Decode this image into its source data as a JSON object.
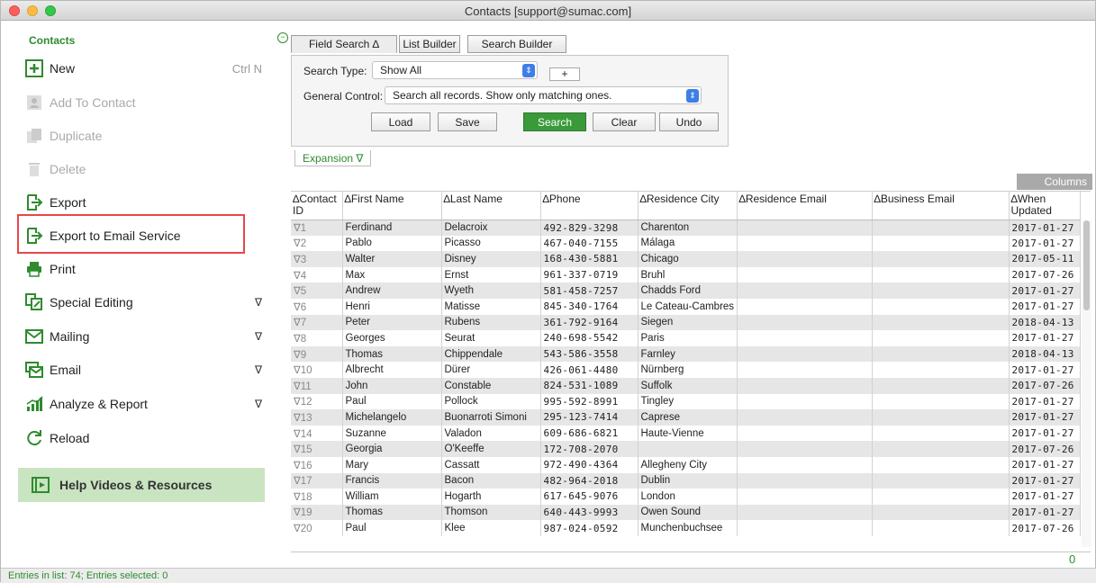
{
  "window": {
    "title": "Contacts   [support@sumac.com]"
  },
  "sidebar": {
    "heading": "Contacts",
    "items": [
      {
        "label": "New",
        "shortcut": "Ctrl N",
        "icon": "new-icon",
        "enabled": true
      },
      {
        "label": "Add To Contact",
        "icon": "add-to-contact-icon",
        "enabled": false
      },
      {
        "label": "Duplicate",
        "icon": "duplicate-icon",
        "enabled": false
      },
      {
        "label": "Delete",
        "icon": "trash-icon",
        "enabled": false
      },
      {
        "label": "Export",
        "icon": "export-icon",
        "enabled": true
      },
      {
        "label": "Export to Email Service",
        "icon": "export-icon",
        "enabled": true,
        "highlighted": true
      },
      {
        "label": "Print",
        "icon": "printer-icon",
        "enabled": true
      },
      {
        "label": "Special Editing",
        "icon": "special-editing-icon",
        "enabled": true,
        "submenu": "∇"
      },
      {
        "label": "Mailing",
        "icon": "mailing-icon",
        "enabled": true,
        "submenu": "∇"
      },
      {
        "label": "Email",
        "icon": "email-icon",
        "enabled": true,
        "submenu": "∇"
      },
      {
        "label": "Analyze & Report",
        "icon": "chart-icon",
        "enabled": true,
        "submenu": "∇"
      },
      {
        "label": "Reload",
        "icon": "reload-icon",
        "enabled": true
      }
    ],
    "help": "Help Videos & Resources"
  },
  "search": {
    "tabs": [
      "Field Search ∆",
      "List Builder",
      "Search Builder"
    ],
    "search_type_label": "Search Type:",
    "search_type_value": "Show All",
    "plus_label": "+",
    "general_control_label": "General Control:",
    "general_control_value": "Search all records. Show only matching ones.",
    "buttons": [
      "Load",
      "Save",
      "Search",
      "Clear",
      "Undo"
    ],
    "expansion_label": "Expansion ∇"
  },
  "columns_button": "Columns",
  "table": {
    "headers": [
      "∆Contact ID",
      "∆First Name",
      "∆Last Name",
      "∆Phone",
      "∆Residence City",
      "∆Residence Email",
      "∆Business Email",
      "∆When Updated"
    ],
    "rows": [
      [
        "∇1",
        "Ferdinand",
        "Delacroix",
        "492-829-3298",
        "Charenton",
        "",
        "",
        "2017-01-27"
      ],
      [
        "∇2",
        "Pablo",
        "Picasso",
        "467-040-7155",
        "Málaga",
        "",
        "",
        "2017-01-27"
      ],
      [
        "∇3",
        "Walter",
        "Disney",
        "168-430-5881",
        "Chicago",
        "",
        "",
        "2017-05-11"
      ],
      [
        "∇4",
        "Max",
        "Ernst",
        "961-337-0719",
        "Bruhl",
        "",
        "",
        "2017-07-26"
      ],
      [
        "∇5",
        "Andrew",
        "Wyeth",
        "581-458-7257",
        "Chadds Ford",
        "",
        "",
        "2017-01-27"
      ],
      [
        "∇6",
        "Henri",
        "Matisse",
        "845-340-1764",
        "Le Cateau-Cambres",
        "",
        "",
        "2017-01-27"
      ],
      [
        "∇7",
        "Peter",
        "Rubens",
        "361-792-9164",
        "Siegen",
        "",
        "",
        "2018-04-13"
      ],
      [
        "∇8",
        "Georges",
        "Seurat",
        "240-698-5542",
        "Paris",
        "",
        "",
        "2017-01-27"
      ],
      [
        "∇9",
        "Thomas",
        "Chippendale",
        "543-586-3558",
        "Farnley",
        "",
        "",
        "2018-04-13"
      ],
      [
        "∇10",
        "Albrecht",
        "Dürer",
        "426-061-4480",
        "Nürnberg",
        "",
        "",
        "2017-01-27"
      ],
      [
        "∇11",
        "John",
        "Constable",
        "824-531-1089",
        "Suffolk",
        "",
        "",
        "2017-07-26"
      ],
      [
        "∇12",
        "Paul",
        "Pollock",
        "995-592-8991",
        "Tingley",
        "",
        "",
        "2017-01-27"
      ],
      [
        "∇13",
        "Michelangelo",
        "Buonarroti Simoni",
        "295-123-7414",
        "Caprese",
        "",
        "",
        "2017-01-27"
      ],
      [
        "∇14",
        "Suzanne",
        "Valadon",
        "609-686-6821",
        "Haute-Vienne",
        "",
        "",
        "2017-01-27"
      ],
      [
        "∇15",
        "Georgia",
        "O'Keeffe",
        "172-708-2070",
        "",
        "",
        "",
        "2017-07-26"
      ],
      [
        "∇16",
        "Mary",
        "Cassatt",
        "972-490-4364",
        "Allegheny City",
        "",
        "",
        "2017-01-27"
      ],
      [
        "∇17",
        "Francis",
        "Bacon",
        "482-964-2018",
        "Dublin",
        "",
        "",
        "2017-01-27"
      ],
      [
        "∇18",
        "William",
        "Hogarth",
        "617-645-9076",
        "London",
        "",
        "",
        "2017-01-27"
      ],
      [
        "∇19",
        "Thomas",
        "Thomson",
        "640-443-9993",
        "Owen Sound",
        "",
        "",
        "2017-01-27"
      ],
      [
        "∇20",
        "Paul",
        "Klee",
        "987-024-0592",
        "Munchenbuchsee",
        "",
        "",
        "2017-07-26"
      ]
    ]
  },
  "selected_count": "0",
  "status": "Entries in list: 74; Entries selected: 0",
  "colors": {
    "accent": "#2e8b2e",
    "highlight_border": "#e8474a",
    "help_bg": "#c9e4c0",
    "primary_button": "#3a9a3a"
  }
}
